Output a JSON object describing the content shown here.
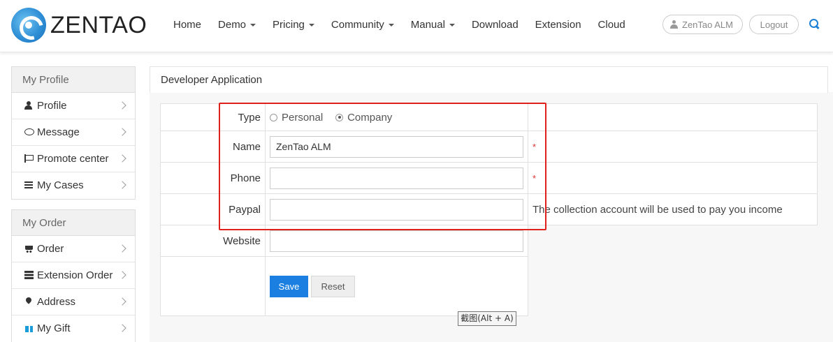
{
  "brand": {
    "name": "ZENTAO"
  },
  "nav": {
    "items": [
      {
        "label": "Home",
        "dropdown": false
      },
      {
        "label": "Demo",
        "dropdown": true
      },
      {
        "label": "Pricing",
        "dropdown": true
      },
      {
        "label": "Community",
        "dropdown": true
      },
      {
        "label": "Manual",
        "dropdown": true
      },
      {
        "label": "Download",
        "dropdown": false
      },
      {
        "label": "Extension",
        "dropdown": false
      },
      {
        "label": "Cloud",
        "dropdown": false
      }
    ],
    "user_label": "ZenTao ALM",
    "logout_label": "Logout",
    "accent_color": "#1a7fd7"
  },
  "sidebar": {
    "profile_section": {
      "title": "My Profile",
      "items": [
        {
          "label": "Profile",
          "icon": "user-icon"
        },
        {
          "label": "Message",
          "icon": "message-icon"
        },
        {
          "label": "Promote center",
          "icon": "flag-icon"
        },
        {
          "label": "My Cases",
          "icon": "list-icon"
        }
      ]
    },
    "order_section": {
      "title": "My Order",
      "items": [
        {
          "label": "Order",
          "icon": "cart-icon"
        },
        {
          "label": "Extension Order",
          "icon": "table-icon"
        },
        {
          "label": "Address",
          "icon": "map-marker-icon"
        },
        {
          "label": "My Gift",
          "icon": "gift-icon"
        }
      ]
    }
  },
  "main": {
    "title": "Developer Application",
    "form": {
      "type": {
        "label": "Type",
        "options": [
          "Personal",
          "Company"
        ],
        "selected": "Company"
      },
      "name": {
        "label": "Name",
        "value": "ZenTao ALM",
        "required_mark": "*"
      },
      "phone": {
        "label": "Phone",
        "value": "",
        "required_mark": "*"
      },
      "paypal": {
        "label": "Paypal",
        "value": "",
        "hint": "The collection account will be used to pay you income"
      },
      "website": {
        "label": "Website",
        "value": ""
      },
      "save_label": "Save",
      "reset_label": "Reset"
    }
  },
  "highlight_color": "#e0201a",
  "tooltip": {
    "text": "截图(Alt + A)"
  }
}
